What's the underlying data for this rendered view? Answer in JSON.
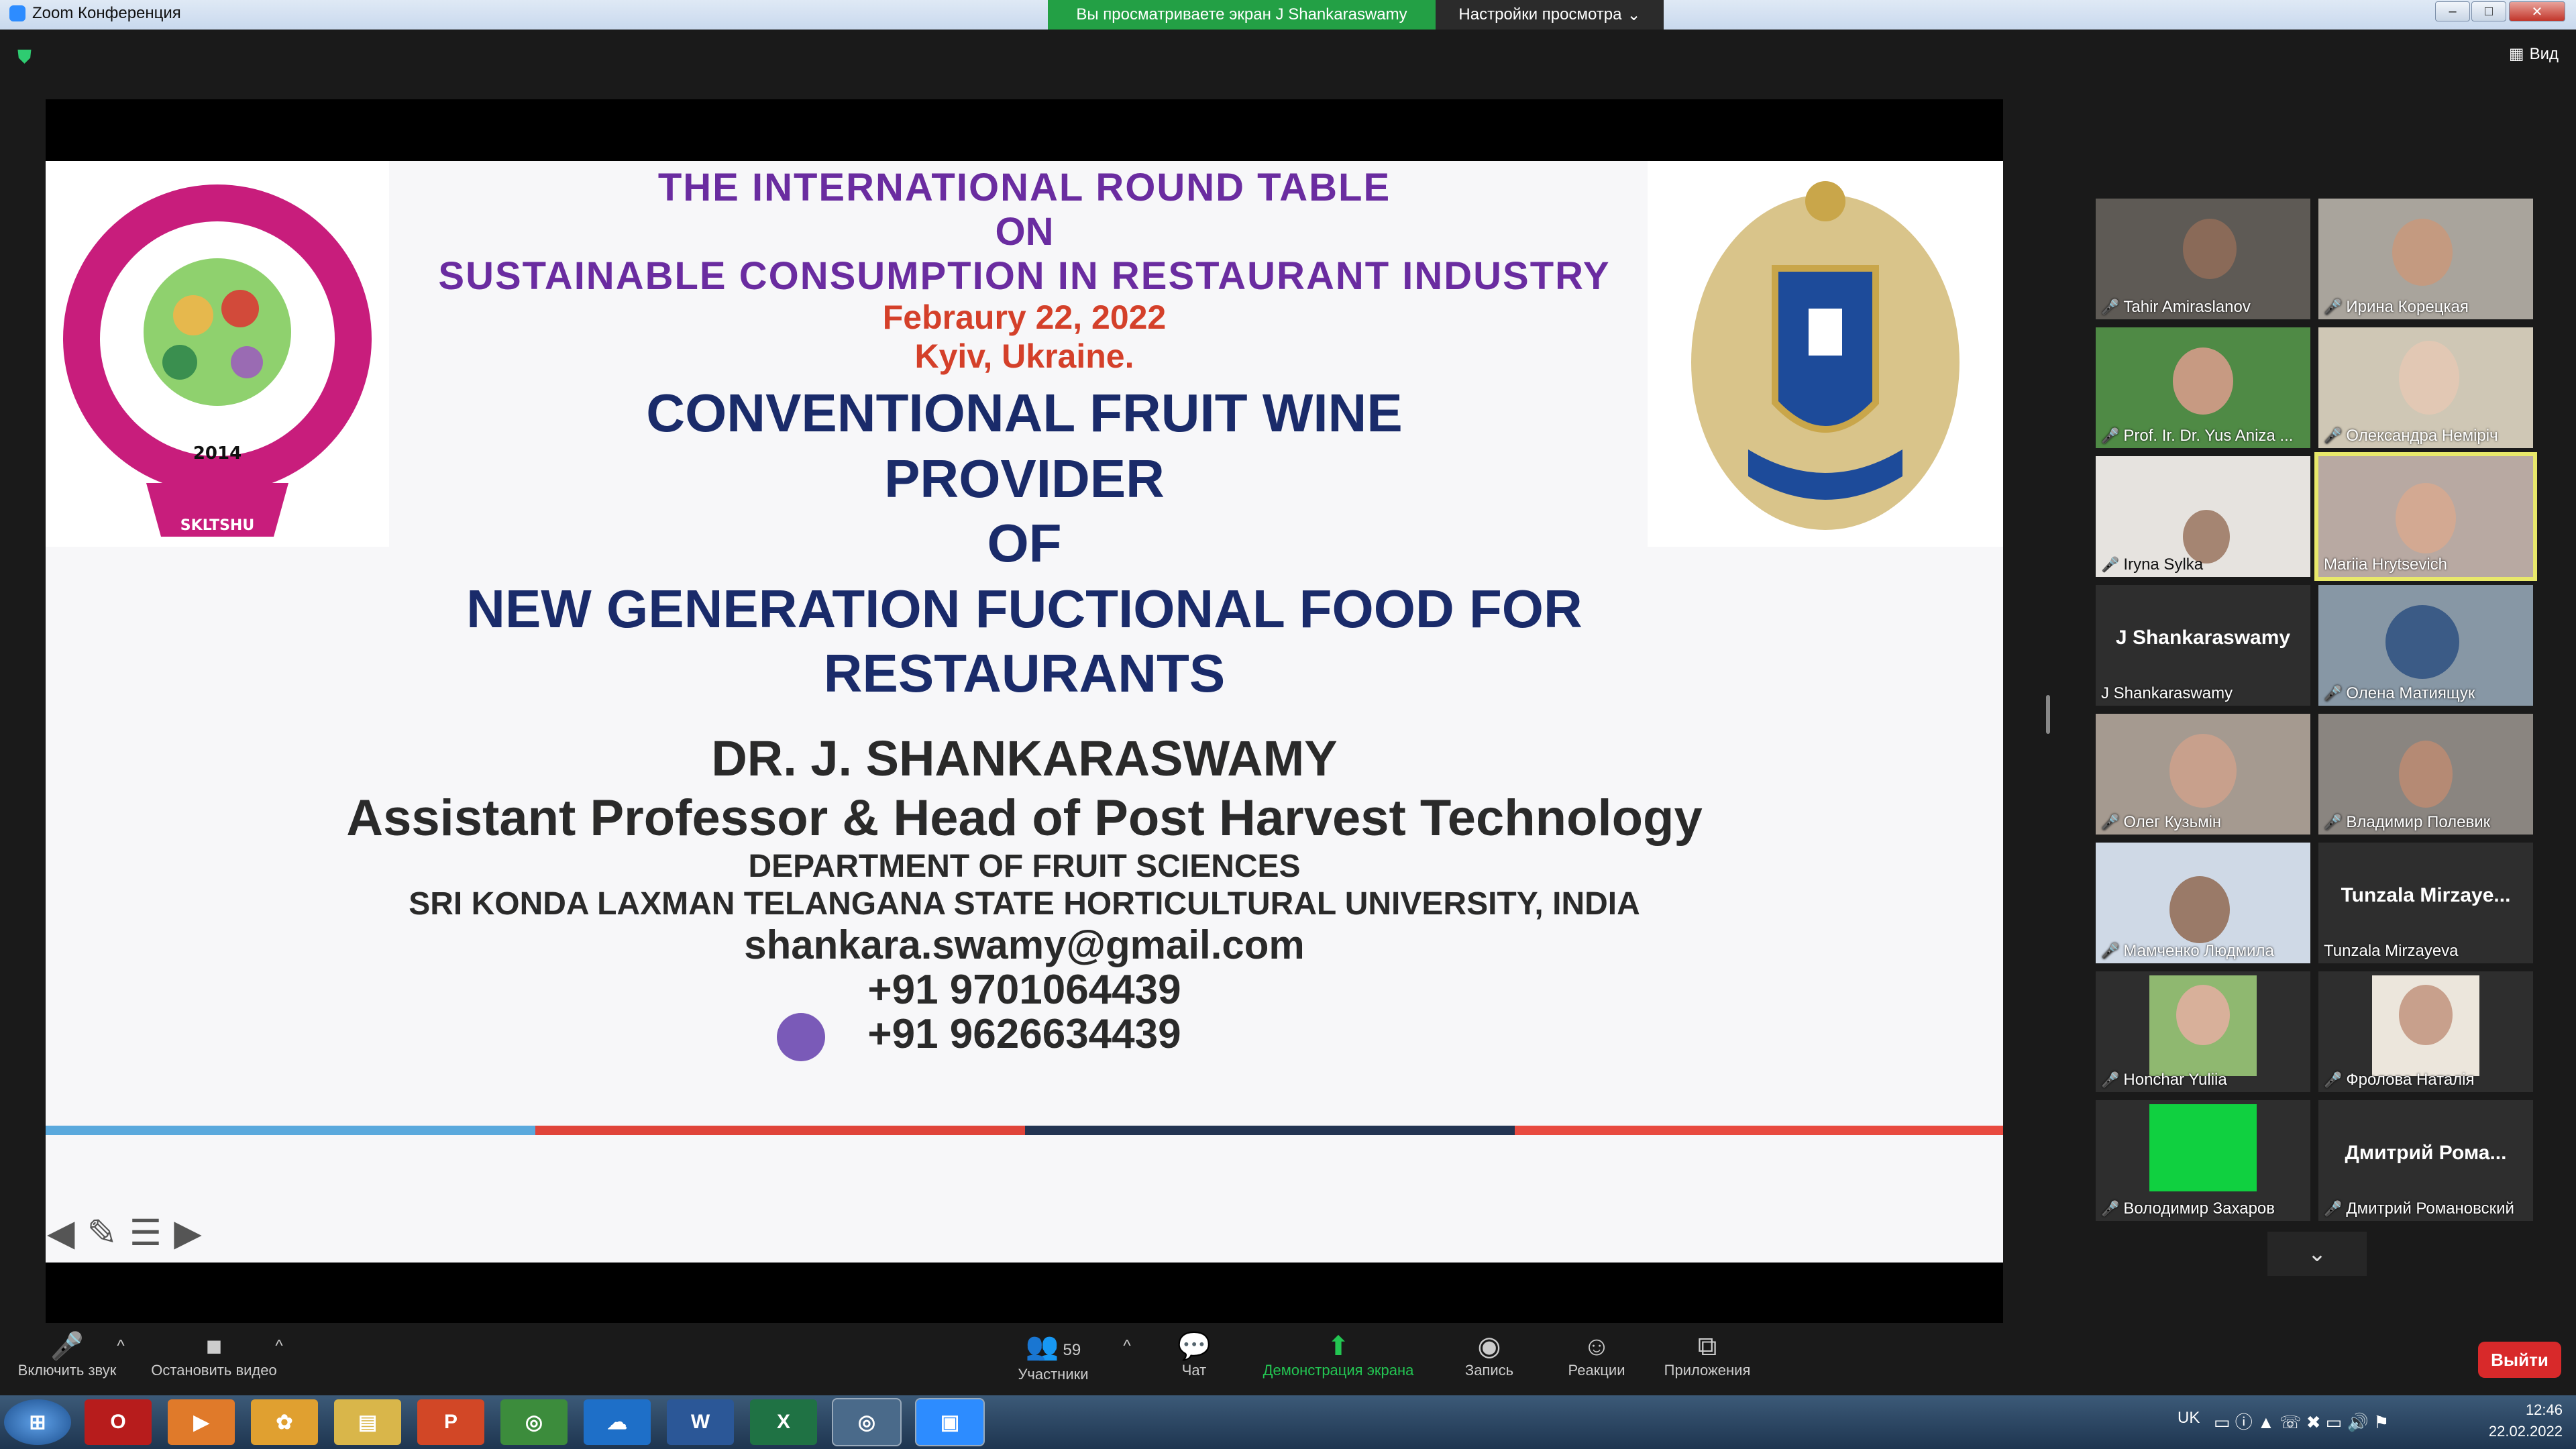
{
  "window": {
    "title": "Zoom Конференция",
    "viewing_banner": "Вы просматриваете экран J Shankaraswamy",
    "view_settings": "Настройки просмотра",
    "view_button": "Вид"
  },
  "slide": {
    "line1": "THE INTERNATIONAL ROUND TABLE",
    "line2": "ON",
    "line3": "SUSTAINABLE CONSUMPTION IN RESTAURANT INDUSTRY",
    "date": "Febraury 22, 2022",
    "place": "Kyiv, Ukraine.",
    "title1": "CONVENTIONAL FRUIT WINE",
    "title2": "PROVIDER",
    "title3": "OF",
    "title4": "NEW GENERATION FUCTIONAL FOOD FOR",
    "title5": "RESTAURANTS",
    "author": "DR. J. SHANKARASWAMY",
    "position": "Assistant Professor & Head of Post Harvest Technology",
    "department": "DEPARTMENT OF FRUIT SCIENCES",
    "university": "SRI KONDA LAXMAN TELANGANA STATE HORTICULTURAL UNIVERSITY, INDIA",
    "email": "shankara.swamy@gmail.com",
    "phone1": "+91 9701064439",
    "phone2": "+91 9626634439",
    "logo_left_year": "2014",
    "logo_left_label": "SKLTSHU",
    "stripe_colors": [
      "#5aa9dd",
      "#e0443a",
      "#233452",
      "#e84a40"
    ]
  },
  "participants": [
    {
      "name": "Tahir Amiraslanov",
      "muted": true
    },
    {
      "name": "Ирина Корецкая",
      "muted": true
    },
    {
      "name": "Prof. Ir. Dr. Yus Aniza ...",
      "muted": true
    },
    {
      "name": "Олександра Неміріч",
      "muted": true
    },
    {
      "name": "Iryna Sylka",
      "muted": true
    },
    {
      "name": "Mariia Hrytsevich",
      "muted": false,
      "active": true
    },
    {
      "name": "J Shankaraswamy",
      "muted": false,
      "display": "J Shankaraswamy"
    },
    {
      "name": "Олена Матиящук",
      "muted": true
    },
    {
      "name": "Олег Кузьмін",
      "muted": true
    },
    {
      "name": "Владимир Полевик",
      "muted": true
    },
    {
      "name": "Мамченко Людмила",
      "muted": true
    },
    {
      "name": "Tunzala Mirzayeva",
      "muted": false,
      "display": "Tunzala Mirzaye..."
    },
    {
      "name": "Honchar Yuliia",
      "muted": true
    },
    {
      "name": "Фролова Наталія",
      "muted": true
    },
    {
      "name": "Володимир Захаров",
      "muted": true
    },
    {
      "name": "Дмитрий Романовский",
      "muted": true,
      "display": "Дмитрий Рома..."
    }
  ],
  "toolbar": {
    "unmute": "Включить звук",
    "stop_video": "Остановить видео",
    "participants": "Участники",
    "participants_count": "59",
    "chat": "Чат",
    "share": "Демонстрация экрана",
    "record": "Запись",
    "reactions": "Реакции",
    "apps": "Приложения",
    "leave": "Выйти"
  },
  "taskbar": {
    "lang": "UK",
    "time": "12:46",
    "date": "22.02.2022"
  }
}
